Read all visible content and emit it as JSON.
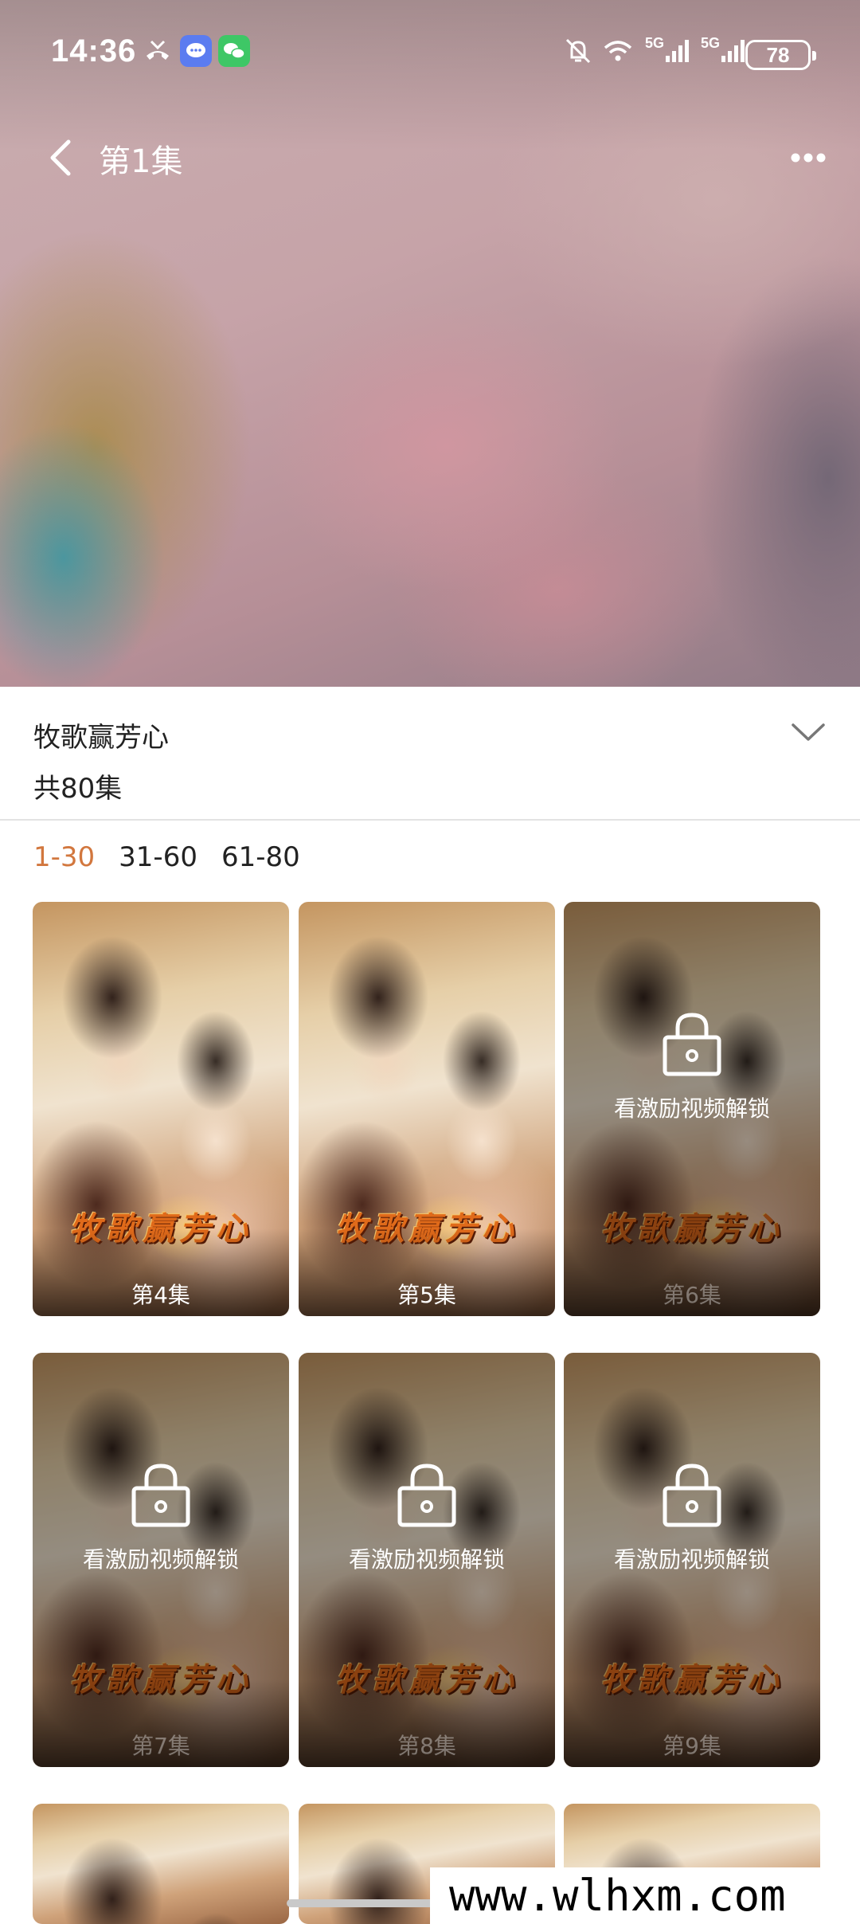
{
  "status_bar": {
    "time": "14:36",
    "battery": "78",
    "network_1": "5G",
    "network_2": "5G"
  },
  "nav": {
    "episode_title": "第1集"
  },
  "drama": {
    "title": "牧歌赢芳心",
    "episode_count": "共80集"
  },
  "ranges": [
    {
      "label": "1-30",
      "active": true
    },
    {
      "label": "31-60",
      "active": false
    },
    {
      "label": "61-80",
      "active": false
    }
  ],
  "poster_logo": "牧歌赢芳心",
  "unlock_text": "看激励视频解锁",
  "episodes": [
    {
      "label": "第4集",
      "locked": false
    },
    {
      "label": "第5集",
      "locked": false
    },
    {
      "label": "第6集",
      "locked": true
    },
    {
      "label": "第7集",
      "locked": true
    },
    {
      "label": "第8集",
      "locked": true
    },
    {
      "label": "第9集",
      "locked": true
    }
  ],
  "watermark": "www.wlhxm.com",
  "colors": {
    "accent": "#d2773e",
    "divider": "#e3e3e3"
  }
}
